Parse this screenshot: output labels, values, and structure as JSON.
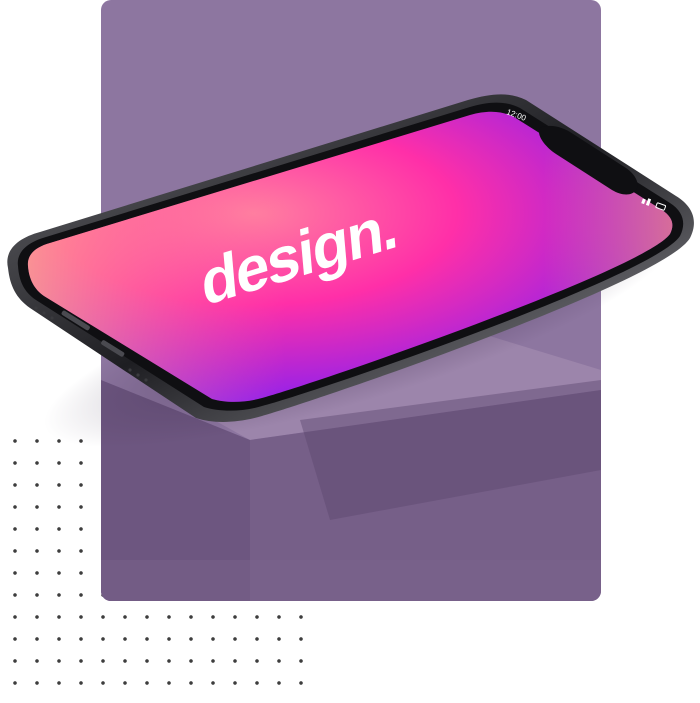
{
  "screen": {
    "wordmark": "design.",
    "status_time": "12:00"
  },
  "colors": {
    "panel": "#8d76a0",
    "pedestal_top": "#9d86ac",
    "pedestal_front": "#775f88",
    "pedestal_side": "#66507a",
    "phone_frame": "#2a2a2e",
    "screen_orange": "#ff8a6a",
    "screen_pink": "#ff2fa8",
    "screen_violet": "#7a1cf0",
    "dots": "#3d3d3d"
  }
}
